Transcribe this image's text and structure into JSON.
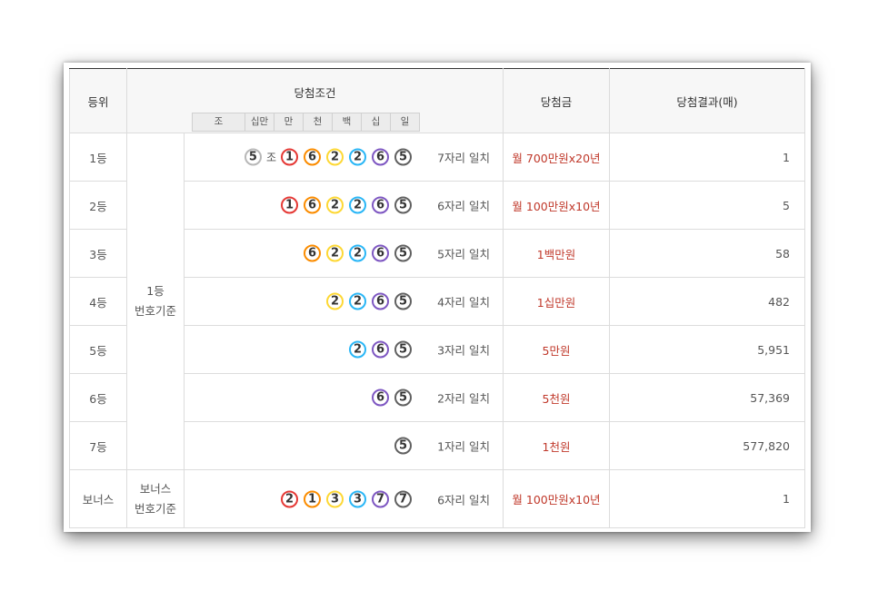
{
  "headers": {
    "rank": "등위",
    "condition": "당첨조건",
    "prize": "당첨금",
    "result": "당첨결과(매)"
  },
  "digit_headers": [
    "조",
    "십만",
    "만",
    "천",
    "백",
    "십",
    "일"
  ],
  "jo_label": "조",
  "basis": {
    "main": [
      "1등",
      "번호기준"
    ],
    "bonus": [
      "보너스",
      "번호기준"
    ]
  },
  "ball_colors": {
    "c0": "#e53935",
    "c1": "#fb8c00",
    "c2": "#fdd835",
    "c3": "#29b6f6",
    "c4": "#7e57c2",
    "c5": "#616161",
    "cjo": "#b8b8b8"
  },
  "prize_color": "#c0392b",
  "rows": [
    {
      "rank": "1등",
      "jo": "5",
      "digits": [
        "1",
        "6",
        "2",
        "2",
        "6",
        "5"
      ],
      "match": "7자리 일치",
      "prize": "월 700만원x20년",
      "count": "1"
    },
    {
      "rank": "2등",
      "jo": null,
      "digits": [
        "1",
        "6",
        "2",
        "2",
        "6",
        "5"
      ],
      "match": "6자리 일치",
      "prize": "월 100만원x10년",
      "count": "5"
    },
    {
      "rank": "3등",
      "jo": null,
      "digits": [
        "6",
        "2",
        "2",
        "6",
        "5"
      ],
      "match": "5자리 일치",
      "prize": "1백만원",
      "count": "58"
    },
    {
      "rank": "4등",
      "jo": null,
      "digits": [
        "2",
        "2",
        "6",
        "5"
      ],
      "match": "4자리 일치",
      "prize": "1십만원",
      "count": "482"
    },
    {
      "rank": "5등",
      "jo": null,
      "digits": [
        "2",
        "6",
        "5"
      ],
      "match": "3자리 일치",
      "prize": "5만원",
      "count": "5,951"
    },
    {
      "rank": "6등",
      "jo": null,
      "digits": [
        "6",
        "5"
      ],
      "match": "2자리 일치",
      "prize": "5천원",
      "count": "57,369"
    },
    {
      "rank": "7등",
      "jo": null,
      "digits": [
        "5"
      ],
      "match": "1자리 일치",
      "prize": "1천원",
      "count": "577,820"
    }
  ],
  "bonus_row": {
    "rank": "보너스",
    "digits": [
      "2",
      "1",
      "3",
      "3",
      "7",
      "7"
    ],
    "match": "6자리 일치",
    "prize": "월 100만원x10년",
    "count": "1"
  }
}
